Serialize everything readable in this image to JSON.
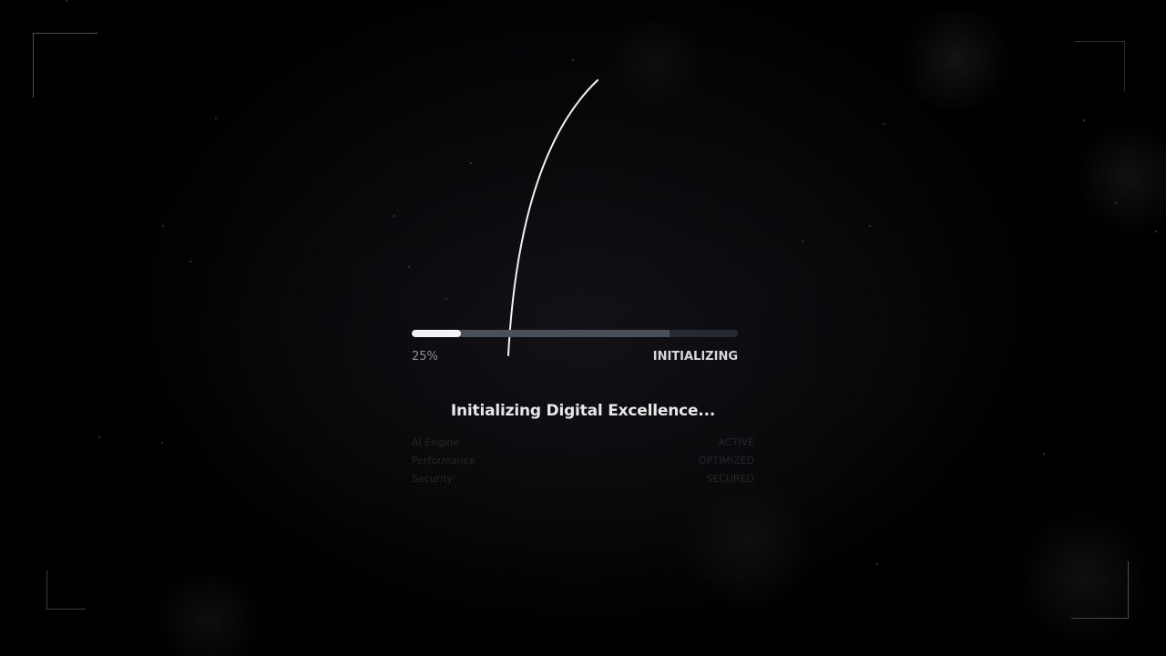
{
  "progress": {
    "percent_label": "25%",
    "value": 0.15,
    "secondary_value": 0.79,
    "phase_label": "INITIALIZING"
  },
  "headline": "Initializing Digital Excellence...",
  "status_items": [
    {
      "label": "AI Engine",
      "value": "ACTIVE"
    },
    {
      "label": "Performance",
      "value": "OPTIMIZED"
    },
    {
      "label": "Security",
      "value": "SECURED"
    }
  ],
  "colors": {
    "background": "#000000",
    "accent": "#f4f4f6",
    "track": "#262a32",
    "muted_text": "#8a8f98"
  },
  "icons": [
    "loading-arc-icon",
    "corner-bracket-icon"
  ]
}
